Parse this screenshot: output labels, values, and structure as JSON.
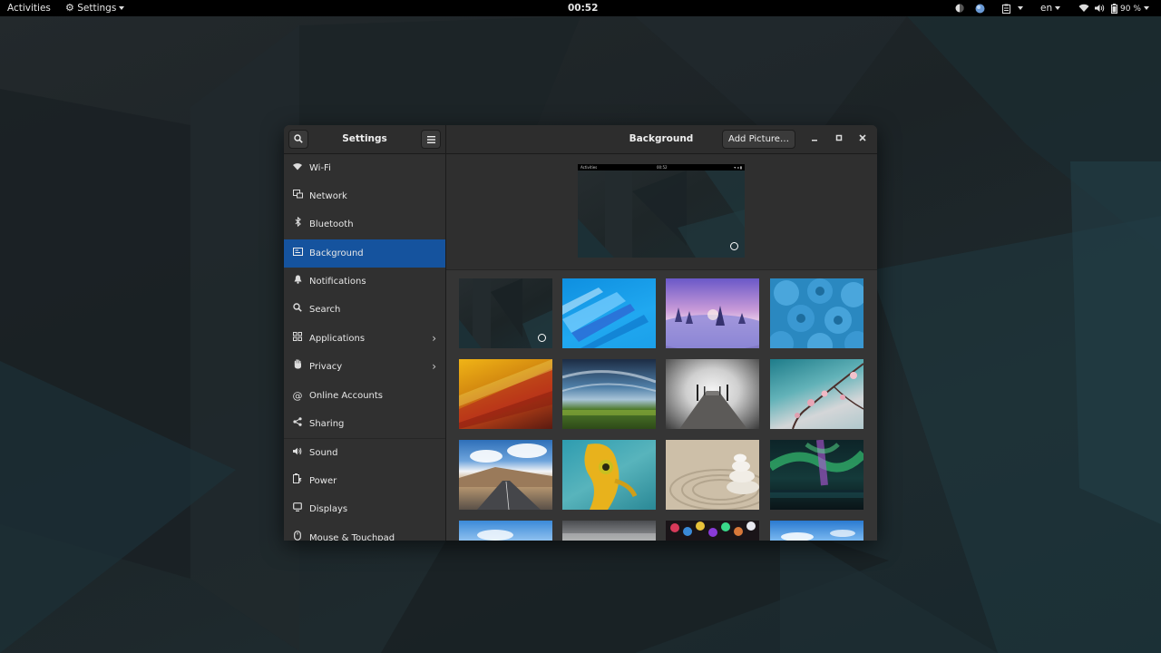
{
  "topbar": {
    "activities": "Activities",
    "app_menu": "Settings",
    "clock": "00:52",
    "language": "en",
    "battery": "90 %"
  },
  "window": {
    "sidebar_title": "Settings",
    "panel_title": "Background",
    "add_picture": "Add Picture…"
  },
  "sidebar": {
    "items": [
      {
        "label": "Wi-Fi",
        "icon": "wifi-icon"
      },
      {
        "label": "Network",
        "icon": "network-icon"
      },
      {
        "label": "Bluetooth",
        "icon": "bluetooth-icon"
      },
      {
        "label": "Background",
        "icon": "background-icon",
        "active": true
      },
      {
        "label": "Notifications",
        "icon": "bell-icon"
      },
      {
        "label": "Search",
        "icon": "search-icon"
      },
      {
        "label": "Applications",
        "icon": "apps-grid-icon",
        "has_submenu": true
      },
      {
        "label": "Privacy",
        "icon": "hand-icon",
        "has_submenu": true
      },
      {
        "label": "Online Accounts",
        "icon": "at-icon"
      },
      {
        "label": "Sharing",
        "icon": "share-icon"
      },
      {
        "label": "Sound",
        "icon": "speaker-icon"
      },
      {
        "label": "Power",
        "icon": "power-icon"
      },
      {
        "label": "Displays",
        "icon": "display-icon"
      },
      {
        "label": "Mouse & Touchpad",
        "icon": "mouse-icon"
      }
    ]
  },
  "preview": {
    "activities": "Activities",
    "clock": "00:52"
  },
  "colors": {
    "accent": "#15539e",
    "window_bg": "#353535",
    "sidebar_bg": "#303030",
    "topbar_bg": "#000000"
  }
}
